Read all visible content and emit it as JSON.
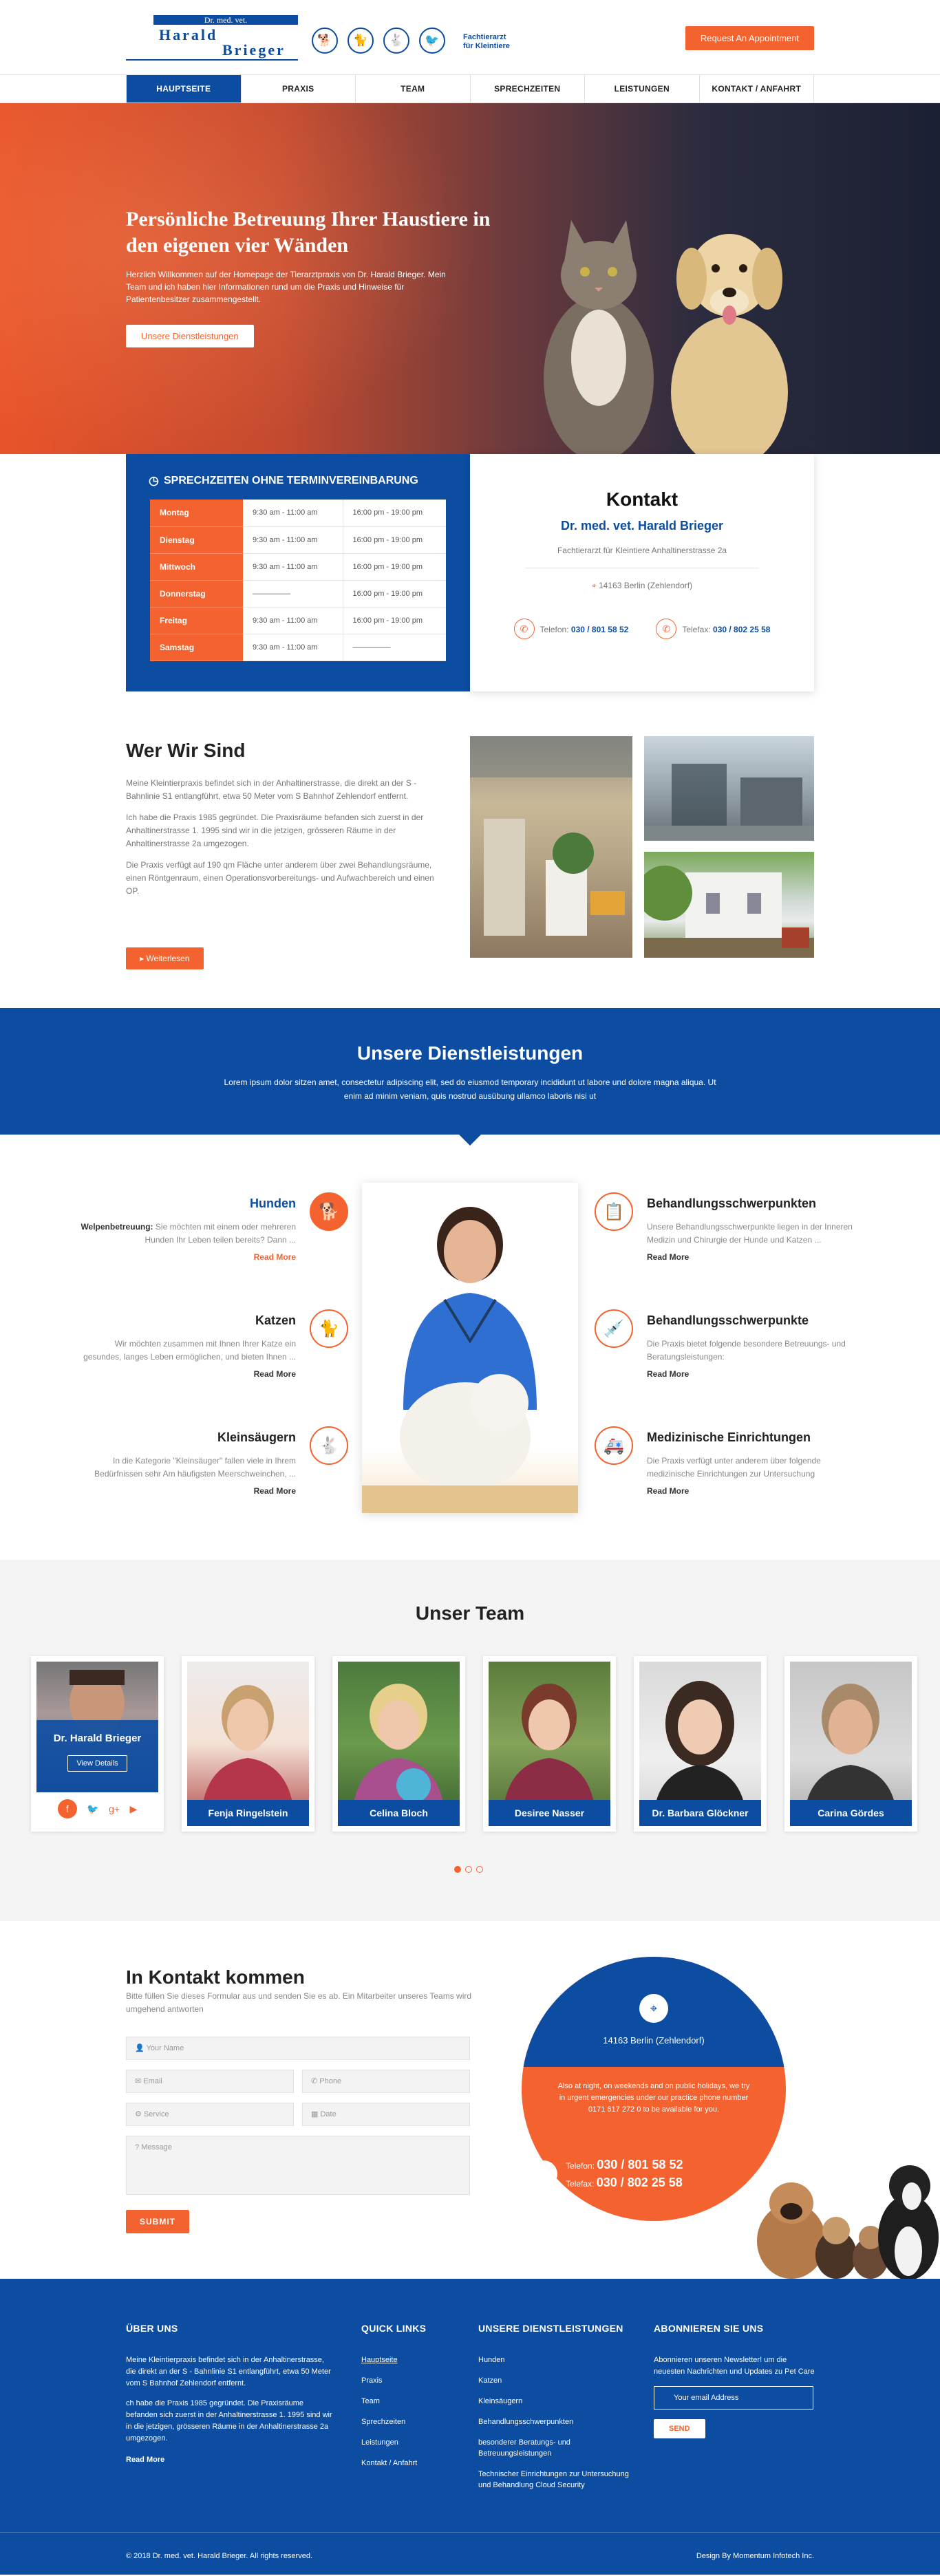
{
  "header": {
    "logo_top": "Dr. med. vet.",
    "logo_name1": "Harald",
    "logo_name2": "Brieger",
    "logo_sub1": "Fachtierarzt",
    "logo_sub2": "für Kleintiere",
    "appointment": "Request An Appointment"
  },
  "nav": [
    "HAUPTSEITE",
    "PRAXIS",
    "TEAM",
    "SPRECHZEITEN",
    "LEISTUNGEN",
    "KONTAKT / ANFAHRT"
  ],
  "hero": {
    "title": "Persönliche Betreuung Ihrer Haustiere in den eigenen vier Wänden",
    "text": "Herzlich Willkommen auf der Homepage der Tierarztpraxis von Dr. Harald Brieger. Mein Team und ich haben hier Informationen rund um die Praxis und Hinweise für Patientenbesitzer zusammengestellt.",
    "button": "Unsere Dienstleistungen"
  },
  "hours": {
    "title": "SPRECHZEITEN OHNE TERMINVEREINBARUNG",
    "rows": [
      {
        "day": "Montag",
        "am": "9:30 am - 11:00 am",
        "pm": "16:00 pm - 19:00 pm"
      },
      {
        "day": "Dienstag",
        "am": "9:30 am - 11:00 am",
        "pm": "16:00 pm - 19:00 pm"
      },
      {
        "day": "Mittwoch",
        "am": "9:30 am - 11:00 am",
        "pm": "16:00 pm - 19:00 pm"
      },
      {
        "day": "Donnerstag",
        "am": "—————",
        "pm": "16:00 pm - 19:00 pm"
      },
      {
        "day": "Freitag",
        "am": "9:30 am - 11:00 am",
        "pm": "16:00 pm - 19:00 pm"
      },
      {
        "day": "Samstag",
        "am": "9:30 am - 11:00 am",
        "pm": "—————"
      }
    ]
  },
  "contact": {
    "title": "Kontakt",
    "name": "Dr. med. vet. Harald Brieger",
    "sub": "Fachtierarzt für Kleintiere Anhaltinerstrasse 2a",
    "address": "14163 Berlin (Zehlendorf)",
    "tel_label": "Telefon:",
    "tel": "030 / 801 58 52",
    "fax_label": "Telefax:",
    "fax": "030 / 802 25 58"
  },
  "about": {
    "title": "Wer Wir Sind",
    "p1": "Meine Kleintierpraxis befindet sich in der Anhaltinerstrasse, die direkt an der S - Bahnlinie S1 entlangführt, etwa 50 Meter vom S Bahnhof Zehlendorf entfernt.",
    "p2": "Ich habe die Praxis 1985 gegründet. Die Praxisräume befanden sich zuerst in der Anhaltinerstrasse 1. 1995 sind wir in die jetzigen, grösseren Räume in der Anhaltinerstrasse 2a umgezogen.",
    "p3": "Die Praxis verfügt auf 190 qm Fläche unter anderem über zwei Behandlungsräume, einen Röntgenraum, einen Operationsvorbereitungs- und Aufwachbereich und einen OP.",
    "button": "Weiterlesen"
  },
  "services_banner": {
    "title": "Unsere Dienstleistungen",
    "text": "Lorem ipsum dolor sitzen amet, consectetur adipiscing elit, sed do eiusmod temporary incididunt ut labore und dolore magna aliqua. Ut enim ad minim veniam, quis nostrud ausübung ullamco laboris nisi ut"
  },
  "services": {
    "left": [
      {
        "title": "Hunden",
        "lead": "Welpenbetreuung:",
        "text": " Sie möchten mit einem oder mehreren Hunden Ihr Leben teilen bereits? Dann ...",
        "more": "Read More",
        "icon": "dog-icon"
      },
      {
        "title": "Katzen",
        "lead": "",
        "text": "Wir möchten zusammen mit Ihnen Ihrer Katze ein gesundes, langes Leben ermöglichen, und bieten Ihnen ...",
        "more": "Read More",
        "icon": "cat-icon"
      },
      {
        "title": "Kleinsäugern",
        "lead": "",
        "text": "In die Kategorie \"Kleinsäuger\" fallen viele in Ihrem Bedürfnissen sehr Am häufigsten Meerschweinchen, ...",
        "more": "Read More",
        "icon": "rabbit-icon"
      }
    ],
    "right": [
      {
        "title": "Behandlungsschwerpunkten",
        "text": "Unsere Behandlungsschwerpunkte liegen in der Inneren Medizin und Chirurgie der Hunde und Katzen ...",
        "more": "Read More",
        "icon": "clipboard-icon"
      },
      {
        "title": "Behandlungsschwerpunkte",
        "text": "Die Praxis bietet folgende besondere Betreuungs- und Beratungsleistungen:",
        "more": "Read More",
        "icon": "syringe-icon"
      },
      {
        "title": "Medizinische Einrichtungen",
        "text": "Die Praxis verfügt unter anderem über folgende medizinische Einrichtungen zur Untersuchung",
        "more": "Read More",
        "icon": "ambulance-icon"
      }
    ]
  },
  "team": {
    "title": "Unser Team",
    "first": {
      "name": "Dr. Harald Brieger",
      "button": "View Details"
    },
    "members": [
      "Fenja Ringelstein",
      "Celina Bloch",
      "Desiree Nasser",
      "Dr. Barbara Glöckner",
      "Carina Gördes"
    ]
  },
  "form": {
    "title": "In Kontakt kommen",
    "lead": "Bitte füllen Sie dieses Formular aus und senden Sie es ab. Ein Mitarbeiter unseres Teams wird umgehend antworten",
    "name": "Your Name",
    "email": "Email",
    "phone": "Phone",
    "service": "Service",
    "date": "Date",
    "message": "Message",
    "submit": "SUBMIT",
    "city": "14163 Berlin (Zehlendorf)",
    "note": "Also at night, on weekends and on public holidays, we try in urgent emergencies under our practice phone number 0171 617 272 0 to be available for you.",
    "tel_label": "Telefon:",
    "tel": "030 / 801 58 52",
    "fax_label": "Telefax:",
    "fax": "030 / 802 25 58"
  },
  "footer": {
    "about_title": "ÜBER UNS",
    "about_p1": "Meine Kleintierpraxis befindet sich in der Anhaltinerstrasse, die direkt an der S - Bahnlinie S1 entlangführt, etwa 50 Meter vom S Bahnhof Zehlendorf entfernt.",
    "about_p2": "ch habe die Praxis 1985 gegründet. Die Praxisräume befanden sich zuerst in der Anhaltinerstrasse 1. 1995 sind wir in die jetzigen, grösseren Räume in der Anhaltinerstrasse 2a umgezogen.",
    "about_more": "Read More",
    "links_title": "QUICK LINKS",
    "links": [
      "Hauptseite",
      "Praxis",
      "Team",
      "Sprechzeiten",
      "Leistungen",
      "Kontakt / Anfahrt"
    ],
    "svc_title": "UNSERE DIENSTLEISTUNGEN",
    "svc_links": [
      "Hunden",
      "Katzen",
      "Kleinsäugern",
      "Behandlungsschwerpunkten",
      "besonderer Beratungs- und Betreuungsleistungen",
      "Technischer Einrichtungen zur Untersuchung und Behandlung Cloud Security"
    ],
    "news_title": "ABONNIEREN SIE UNS",
    "news_text": "Abonnieren unseren Newsletter! um die neuesten Nachrichten und Updates zu Pet Care",
    "news_placeholder": "Your email Address",
    "news_button": "SEND",
    "copyright": "© 2018 Dr. med. vet. Harald Brieger. All rights reserved.",
    "design": "Design By Momentum Infotech Inc."
  },
  "colors": {
    "primary": "#0c4da2",
    "accent": "#f4632f"
  }
}
